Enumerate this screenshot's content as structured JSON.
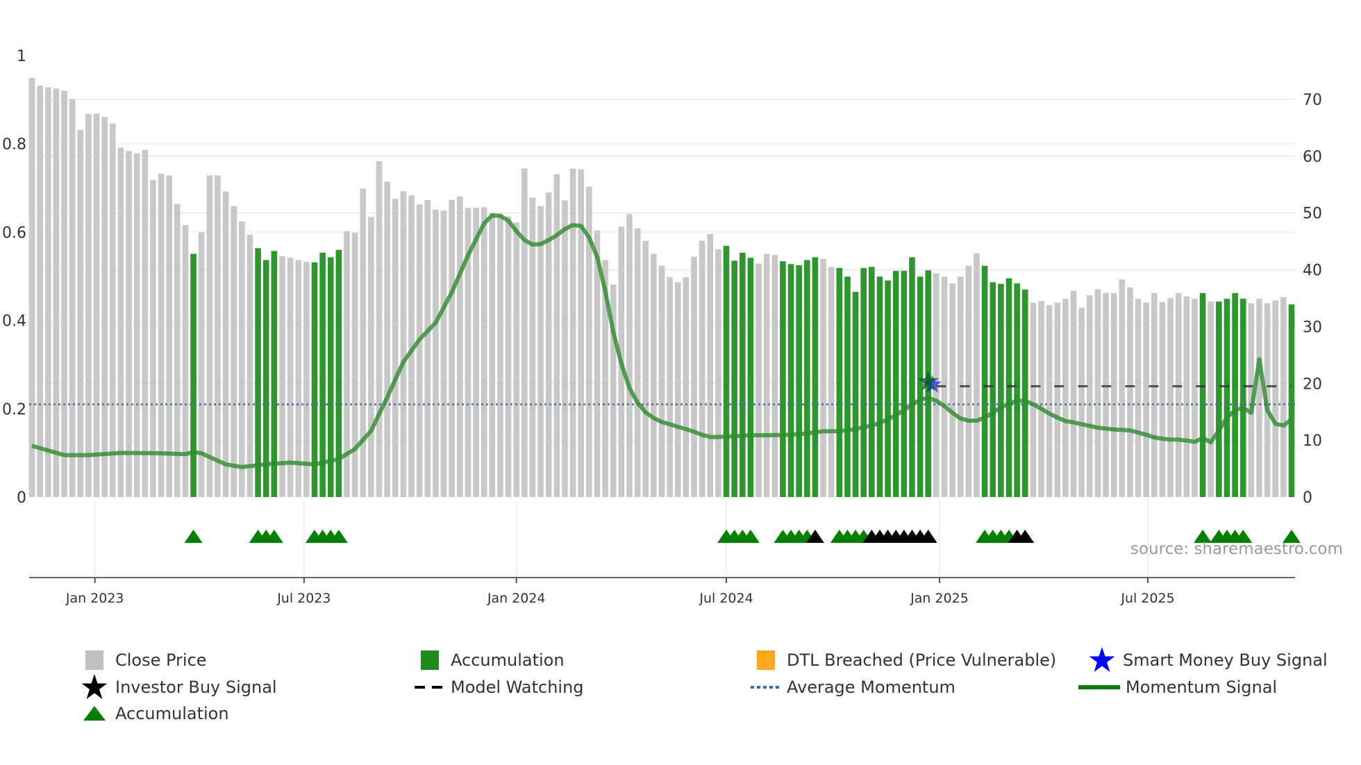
{
  "chart_data": {
    "type": "bar",
    "x_unit": "week index",
    "x_ticks": [
      "Jan 2023",
      "Jul 2023",
      "Jan 2024",
      "Jul 2024",
      "Jan 2025",
      "Jul 2025"
    ],
    "x_tick_positions": [
      8.8,
      34.7,
      61,
      87,
      113.4,
      139.2
    ],
    "left_axis": {
      "ticks": [
        "0",
        "0.2",
        "0.4",
        "0.6",
        "0.8",
        "1"
      ],
      "range": [
        0,
        1
      ]
    },
    "right_axis": {
      "ticks": [
        "0",
        "10",
        "20",
        "30",
        "40",
        "50",
        "60",
        "70"
      ],
      "range": [
        0,
        70
      ]
    },
    "close_price": [
      73.8,
      72.4,
      72.1,
      71.9,
      71.5,
      70.0,
      64.6,
      67.4,
      67.5,
      66.9,
      65.7,
      61.5,
      60.9,
      60.5,
      61.1,
      55.8,
      56.9,
      56.6,
      51.6,
      47.9,
      42.8,
      46.6,
      56.6,
      56.6,
      53.8,
      51.2,
      48.5,
      46.2,
      43.8,
      41.7,
      43.3,
      42.4,
      42.1,
      41.7,
      41.4,
      41.3,
      43.0,
      42.2,
      43.5,
      46.8,
      46.5,
      54.3,
      49.3,
      59.1,
      55.5,
      52.5,
      53.8,
      53.1,
      51.5,
      52.3,
      50.6,
      50.4,
      52.3,
      52.9,
      50.9,
      50.9,
      51.0,
      50.0,
      49.8,
      49.4,
      48.3,
      57.8,
      52.7,
      51.2,
      53.6,
      56.8,
      52.2,
      57.8,
      57.7,
      54.6,
      46.9,
      41.7,
      37.4,
      47.6,
      49.8,
      47.3,
      45.1,
      42.8,
      40.7,
      38.7,
      37.8,
      38.7,
      42.3,
      45.1,
      46.3,
      43.6,
      44.2,
      41.6,
      43.0,
      42.1,
      41.1,
      42.8,
      42.6,
      41.5,
      41.0,
      40.8,
      41.7,
      42.2,
      41.9,
      40.5,
      40.3,
      38.8,
      36.1,
      40.3,
      40.5,
      38.8,
      38.1,
      39.8,
      39.8,
      42.2,
      38.8,
      39.9,
      39.4,
      38.8,
      37.6,
      38.8,
      40.7,
      42.9,
      40.7,
      37.8,
      37.5,
      38.5,
      37.6,
      36.5,
      34.2,
      34.5,
      33.8,
      34.2,
      34.9,
      36.3,
      33.3,
      35.5,
      36.6,
      35.9,
      35.9,
      38.3,
      36.9,
      34.9,
      34.2,
      35.9,
      34.3,
      35.0,
      35.9,
      35.3,
      34.9,
      35.9,
      34.4,
      34.4,
      34.9,
      35.9,
      34.9,
      34.1,
      34.9,
      34.1,
      34.6,
      35.2,
      33.9
    ],
    "accumulation_bars": [
      21,
      29,
      30,
      31,
      36,
      37,
      38,
      39,
      87,
      88,
      89,
      90,
      94,
      95,
      96,
      97,
      98,
      101,
      102,
      103,
      104,
      105,
      106,
      107,
      108,
      109,
      110,
      111,
      112,
      119,
      120,
      121,
      122,
      123,
      124,
      146,
      148,
      149,
      150,
      151,
      157
    ],
    "momentum": {
      "x": [
        1,
        5,
        8,
        12,
        17,
        20,
        21,
        22,
        25,
        27,
        30,
        33,
        36,
        39,
        41,
        43,
        45,
        47,
        49,
        51,
        53,
        55,
        57,
        58,
        59,
        60,
        61,
        62,
        63,
        64,
        65,
        66,
        67,
        68,
        69,
        70,
        71,
        72,
        73,
        74,
        75,
        76,
        77,
        78,
        79,
        80,
        81,
        82,
        83,
        84,
        85,
        86,
        88,
        90,
        92,
        95,
        97,
        99,
        101,
        103,
        105,
        106,
        108,
        110,
        111,
        112,
        113,
        114,
        115,
        116,
        117,
        118,
        119,
        120,
        121,
        122,
        123,
        124,
        125,
        126,
        127,
        128,
        129,
        130,
        131,
        132,
        133,
        134,
        135,
        136,
        137,
        138,
        139,
        140,
        141,
        142,
        143,
        144,
        145,
        146,
        147,
        148,
        149,
        150,
        151,
        152,
        153,
        154,
        155,
        156,
        157
      ],
      "y": [
        0.116,
        0.095,
        0.095,
        0.1,
        0.099,
        0.097,
        0.102,
        0.099,
        0.074,
        0.068,
        0.074,
        0.078,
        0.074,
        0.086,
        0.109,
        0.15,
        0.226,
        0.306,
        0.357,
        0.395,
        0.464,
        0.547,
        0.62,
        0.638,
        0.637,
        0.626,
        0.602,
        0.582,
        0.572,
        0.573,
        0.582,
        0.593,
        0.607,
        0.616,
        0.614,
        0.588,
        0.544,
        0.467,
        0.374,
        0.302,
        0.247,
        0.214,
        0.192,
        0.179,
        0.17,
        0.165,
        0.159,
        0.154,
        0.148,
        0.141,
        0.136,
        0.136,
        0.138,
        0.14,
        0.14,
        0.141,
        0.144,
        0.149,
        0.149,
        0.154,
        0.162,
        0.168,
        0.185,
        0.21,
        0.22,
        0.225,
        0.218,
        0.206,
        0.191,
        0.178,
        0.173,
        0.173,
        0.18,
        0.191,
        0.203,
        0.212,
        0.218,
        0.218,
        0.21,
        0.2,
        0.189,
        0.18,
        0.172,
        0.169,
        0.165,
        0.161,
        0.157,
        0.155,
        0.153,
        0.152,
        0.151,
        0.146,
        0.141,
        0.135,
        0.132,
        0.13,
        0.13,
        0.128,
        0.125,
        0.134,
        0.124,
        0.151,
        0.18,
        0.197,
        0.202,
        0.191,
        0.312,
        0.197,
        0.166,
        0.162,
        0.176
      ]
    },
    "average_momentum": 0.21,
    "model_watching": {
      "value": 19.5,
      "from_x": 113
    },
    "smart_money_buy": {
      "x": 112,
      "value": 19.8
    },
    "triangles": {
      "accumulation": [
        21,
        29,
        30,
        31,
        36,
        37,
        38,
        39,
        87,
        88,
        89,
        90,
        94,
        95,
        96,
        97,
        101,
        102,
        103,
        104,
        119,
        120,
        121,
        122,
        146,
        148,
        149,
        150,
        151,
        157
      ],
      "investor": [
        98,
        105,
        106,
        107,
        108,
        109,
        110,
        111,
        112,
        123,
        124
      ]
    },
    "source": "source: sharemaestro.com",
    "legend": [
      {
        "label": "Close Price",
        "icon": "gray-square"
      },
      {
        "label": "Accumulation",
        "icon": "green-square"
      },
      {
        "label": "DTL Breached (Price Vulnerable)",
        "icon": "orange-square"
      },
      {
        "label": "Smart Money Buy Signal",
        "icon": "blue-star"
      },
      {
        "label": "Investor Buy Signal",
        "icon": "black-star"
      },
      {
        "label": "Model Watching",
        "icon": "black-dashes"
      },
      {
        "label": "Average Momentum",
        "icon": "blue-dots"
      },
      {
        "label": "Momentum Signal",
        "icon": "green-line"
      },
      {
        "label": "Accumulation",
        "icon": "green-triangle"
      }
    ],
    "colors": {
      "price": "#c8c8c8",
      "accumulation": "#2f962f",
      "momentum": "#2e8b2e",
      "average": "#4a7099",
      "watching": "#333333",
      "smart_money": "#0000ff",
      "dtl": "#ffa91f",
      "triangle_acc": "#008000",
      "triangle_inv": "#000000"
    }
  }
}
